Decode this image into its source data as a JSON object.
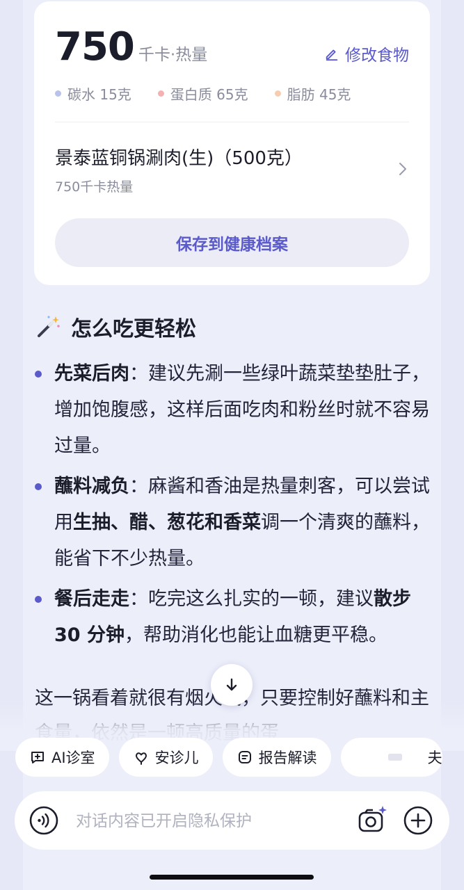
{
  "nutrition_card": {
    "calories_value": "750",
    "calories_unit": "千卡·热量",
    "edit_label": "修改食物",
    "macros": [
      {
        "label": "碳水 15克",
        "color": "#b9c2ea"
      },
      {
        "label": "蛋白质 65克",
        "color": "#f3b1b1"
      },
      {
        "label": "脂肪 45克",
        "color": "#f6cdb1"
      }
    ],
    "food_item": {
      "name": "景泰蓝铜锅涮肉(生)（500克）",
      "subtitle": "750千卡热量"
    },
    "save_label": "保存到健康档案"
  },
  "advice": {
    "title": "怎么吃更轻松",
    "tips": [
      {
        "bold_head": "先菜后肉",
        "text": "：建议先涮一些绿叶蔬菜垫垫肚子，增加饱腹感，这样后面吃肉和粉丝时就不容易过量。"
      },
      {
        "bold_head": "蘸料减负",
        "text_a": "：麻酱和香油是热量刺客，可以尝试用",
        "bold_mid": "生抽、醋、葱花和香菜",
        "text_b": "调一个清爽的蘸料，能省下不少热量。"
      },
      {
        "bold_head": "餐后走走",
        "text_a": "：吃完这么扎实的一顿，建议",
        "bold_mid": "散步 30 分钟",
        "text_b": "，帮助消化也能让血糖更平稳。"
      }
    ],
    "summary": "这一锅看着就很有烟火气，只要控制好蘸料和主食量，依然是一顿高质量的蛋"
  },
  "chips": [
    {
      "label": "AI诊室",
      "icon": "chat-plus-icon"
    },
    {
      "label": "安诊儿",
      "icon": "heart-flower-icon"
    },
    {
      "label": "报告解读",
      "icon": "report-icon"
    },
    {
      "label": "夫",
      "icon": "blurred-icon"
    }
  ],
  "input_bar": {
    "placeholder": "对话内容已开启隐私保护"
  },
  "colors": {
    "accent": "#5a5acb",
    "background": "#eceefa"
  }
}
